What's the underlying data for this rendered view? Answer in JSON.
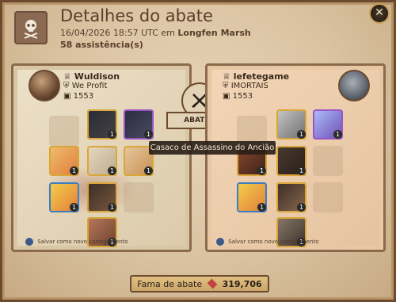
{
  "header": {
    "title": "Detalhes do abate",
    "datetime": "16/04/2026 18:57 UTC",
    "location_prefix": "em",
    "location": "Longfen Marsh",
    "assists": "58 assistência(s)"
  },
  "center": {
    "abateu_label": "ABATEU"
  },
  "tooltip": {
    "text": "Casaco de Assassino do Ancião"
  },
  "killer": {
    "name": "Wuldison",
    "guild": "We Profit",
    "ip": "1553",
    "save_text": "Salvar como novo carregamento",
    "items": [
      {
        "name": "head-item",
        "quality": "1"
      },
      {
        "name": "cape-item",
        "quality": "1"
      },
      {
        "name": "mainhand-item",
        "quality": "1"
      },
      {
        "name": "chest-item",
        "quality": "1"
      },
      {
        "name": "offhand-item",
        "quality": "1"
      },
      {
        "name": "potion-item",
        "quality": "1"
      },
      {
        "name": "boots-item",
        "quality": "1"
      },
      {
        "name": "mount-item",
        "quality": "1"
      }
    ]
  },
  "victim": {
    "name": "lefetegame",
    "guild": "IMORTAIS",
    "ip": "1553",
    "save_text": "Salvar como novo carregamento",
    "items": [
      {
        "name": "head-item",
        "quality": "1"
      },
      {
        "name": "cape-item",
        "quality": "1"
      },
      {
        "name": "mainhand-item",
        "quality": "1"
      },
      {
        "name": "chest-item",
        "quality": "1"
      },
      {
        "name": "potion-item",
        "quality": "1"
      },
      {
        "name": "boots-item",
        "quality": "1"
      },
      {
        "name": "mount-item",
        "quality": "1"
      }
    ]
  },
  "fame": {
    "label": "Fama de abate",
    "value": "319,706"
  },
  "icons": [
    "skull-crossbones-icon",
    "close-icon",
    "crossed-swords-icon",
    "crown-icon",
    "guild-icon",
    "item-power-icon",
    "save-icon",
    "fame-gem-icon"
  ],
  "colors": {
    "quality_gold": "#d9a637",
    "quality_purple": "#9a54c8",
    "quality_blue": "#3d7ec0",
    "panel_border": "#6b4a2e"
  }
}
